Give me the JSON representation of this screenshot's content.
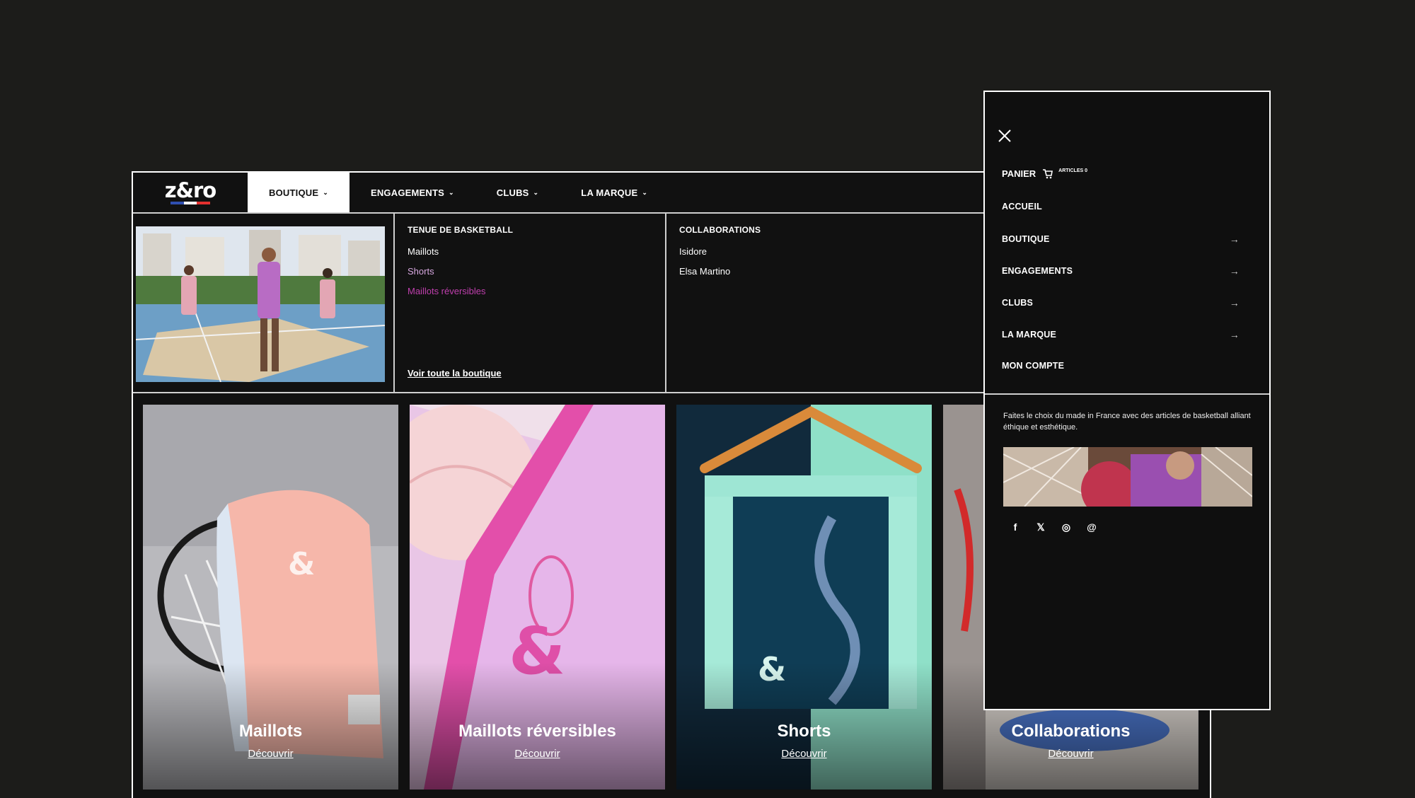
{
  "brand": {
    "logo_text": "z&ro",
    "flag_colors": [
      "#2f4fb0",
      "#ffffff",
      "#e4302f"
    ]
  },
  "topnav": {
    "items": [
      {
        "label": "BOUTIQUE",
        "active": true
      },
      {
        "label": "ENGAGEMENTS",
        "active": false
      },
      {
        "label": "CLUBS",
        "active": false
      },
      {
        "label": "LA MARQUE",
        "active": false
      }
    ],
    "chevron_icon": "chevron-down-icon"
  },
  "mega_menu": {
    "col1": {
      "title": "TENUE DE BASKETBALL",
      "links": [
        {
          "label": "Maillots",
          "color": "#ffffff"
        },
        {
          "label": "Shorts",
          "color": "#d8a8e0"
        },
        {
          "label": "Maillots réversibles",
          "color": "#c03fae"
        }
      ]
    },
    "col2": {
      "title": "COLLABORATIONS",
      "links": [
        {
          "label": "Isidore"
        },
        {
          "label": "Elsa Martino"
        }
      ]
    },
    "see_all": "Voir toute la boutique"
  },
  "cards": [
    {
      "title": "Maillots",
      "link": "Découvrir"
    },
    {
      "title": "Maillots réversibles",
      "link": "Découvrir"
    },
    {
      "title": "Shorts",
      "link": "Découvrir"
    },
    {
      "title": "Collaborations",
      "link": "Découvrir"
    }
  ],
  "side_panel": {
    "close_icon": "close-icon",
    "cart_label": "PANIER",
    "cart_icon": "cart-icon",
    "cart_count": "ARTICLES 0",
    "items": [
      {
        "label": "ACCUEIL",
        "arrow": false
      },
      {
        "label": "BOUTIQUE",
        "arrow": true
      },
      {
        "label": "ENGAGEMENTS",
        "arrow": true
      },
      {
        "label": "CLUBS",
        "arrow": true
      },
      {
        "label": "LA MARQUE",
        "arrow": true
      },
      {
        "label": "MON COMPTE",
        "arrow": false
      }
    ],
    "arrow_glyph": "→",
    "description": "Faites le choix du made in France avec des articles de basketball alliant éthique et esthétique.",
    "socials": [
      {
        "icon": "facebook-icon",
        "glyph": "f"
      },
      {
        "icon": "x-icon",
        "glyph": "𝕏"
      },
      {
        "icon": "instagram-icon",
        "glyph": "◎"
      },
      {
        "icon": "threads-icon",
        "glyph": "@"
      }
    ]
  },
  "colors": {
    "background": "#1c1c1a",
    "panel": "#0f0f0f",
    "accent_pink": "#c03fae"
  }
}
